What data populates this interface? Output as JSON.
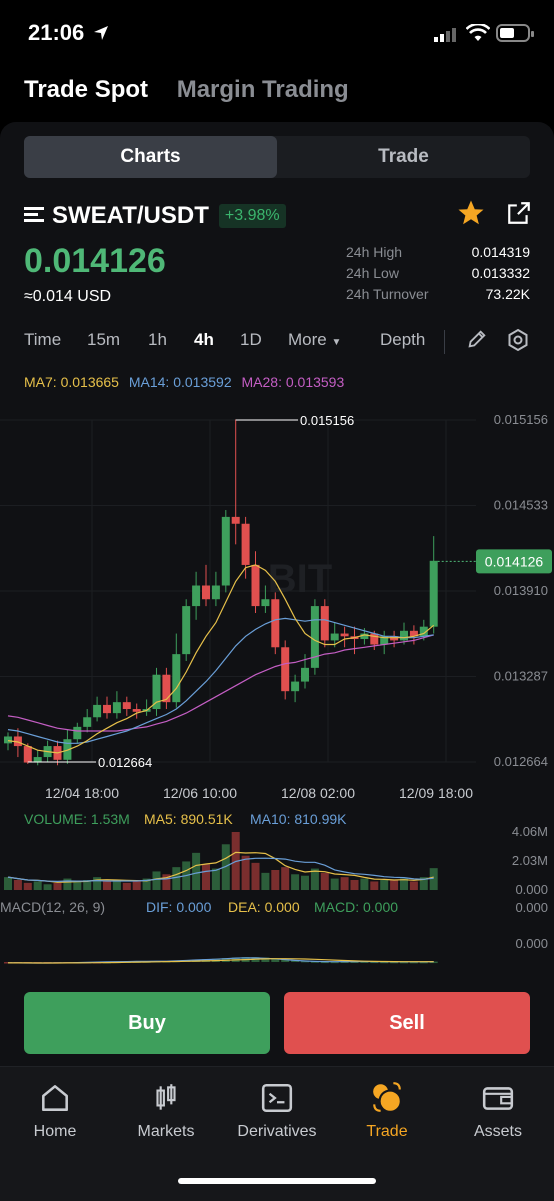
{
  "status_bar": {
    "time": "21:06"
  },
  "top_tabs": [
    "Trade Spot",
    "Margin Trading"
  ],
  "segment": {
    "charts": "Charts",
    "trade": "Trade"
  },
  "pair": {
    "name": "SWEAT/USDT",
    "change": "+3.98%"
  },
  "price": {
    "last": "0.014126",
    "usd": "≈0.014 USD"
  },
  "stats": {
    "high_label": "24h High",
    "high": "0.014319",
    "low_label": "24h Low",
    "low": "0.013332",
    "turnover_label": "24h Turnover",
    "turnover": "73.22K"
  },
  "timeframes": {
    "time": "Time",
    "m15": "15m",
    "h1": "1h",
    "h4": "4h",
    "d1": "1D",
    "more": "More",
    "depth": "Depth",
    "active": "4h"
  },
  "ma_legend": {
    "ma7": "MA7: 0.013665",
    "ma14": "MA14: 0.013592",
    "ma28": "MA28: 0.013593"
  },
  "volume_legend": {
    "vol": "VOLUME: 1.53M",
    "ma5": "MA5: 890.51K",
    "ma10": "MA10: 810.99K"
  },
  "macd_legend": {
    "macd": "MACD(12, 26, 9)",
    "dif": "DIF: 0.000",
    "dea": "DEA: 0.000",
    "val": "MACD: 0.000"
  },
  "colors": {
    "up": "#3e9f5c",
    "down": "#e0504f",
    "ma7": "#e6c04a",
    "ma14": "#6a9fd8",
    "ma28": "#c45ec4",
    "accent": "#f5a623"
  },
  "chart_data": {
    "type": "candlestick",
    "price_axis": [
      "0.015156",
      "0.014533",
      "0.013910",
      "0.013287",
      "0.012664"
    ],
    "volume_axis": [
      "4.06M",
      "2.03M",
      "0.000"
    ],
    "macd_axis": [
      "0.000",
      "0.000"
    ],
    "time_labels": [
      "12/04 18:00",
      "12/06 10:00",
      "12/08 02:00",
      "12/09 18:00"
    ],
    "high_marker": "0.015156",
    "low_marker": "0.012664",
    "last_price_tag": "0.014126",
    "candles": [
      [
        0.0128,
        0.01285,
        0.01275,
        0.01288
      ],
      [
        0.01285,
        0.01278,
        0.0127,
        0.01291
      ],
      [
        0.01278,
        0.01266,
        0.01265,
        0.0128
      ],
      [
        0.01266,
        0.0127,
        0.01264,
        0.01275
      ],
      [
        0.0127,
        0.01278,
        0.01266,
        0.01282
      ],
      [
        0.01278,
        0.01268,
        0.01264,
        0.01282
      ],
      [
        0.01268,
        0.01283,
        0.01265,
        0.0129
      ],
      [
        0.01283,
        0.01292,
        0.0128,
        0.01295
      ],
      [
        0.01292,
        0.01299,
        0.01288,
        0.01305
      ],
      [
        0.01299,
        0.01308,
        0.01296,
        0.01314
      ],
      [
        0.01308,
        0.01302,
        0.01298,
        0.01314
      ],
      [
        0.01302,
        0.0131,
        0.01298,
        0.01318
      ],
      [
        0.0131,
        0.01305,
        0.013,
        0.01314
      ],
      [
        0.01305,
        0.01303,
        0.01298,
        0.01309
      ],
      [
        0.01303,
        0.01305,
        0.013,
        0.01312
      ],
      [
        0.01305,
        0.0133,
        0.013,
        0.01335
      ],
      [
        0.0133,
        0.0131,
        0.01305,
        0.01335
      ],
      [
        0.0131,
        0.01345,
        0.01306,
        0.0136
      ],
      [
        0.01345,
        0.0138,
        0.0134,
        0.01385
      ],
      [
        0.0138,
        0.01395,
        0.0137,
        0.01405
      ],
      [
        0.01395,
        0.01385,
        0.0138,
        0.0141
      ],
      [
        0.01385,
        0.01395,
        0.0138,
        0.01405
      ],
      [
        0.01395,
        0.01445,
        0.0139,
        0.0145
      ],
      [
        0.01445,
        0.0144,
        0.01425,
        0.01516
      ],
      [
        0.0144,
        0.0141,
        0.014,
        0.01445
      ],
      [
        0.0141,
        0.0138,
        0.01375,
        0.0142
      ],
      [
        0.0138,
        0.01385,
        0.01375,
        0.01395
      ],
      [
        0.01385,
        0.0135,
        0.01345,
        0.0139
      ],
      [
        0.0135,
        0.01318,
        0.01312,
        0.01355
      ],
      [
        0.01318,
        0.01325,
        0.0131,
        0.0133
      ],
      [
        0.01325,
        0.01335,
        0.0132,
        0.01345
      ],
      [
        0.01335,
        0.0138,
        0.0133,
        0.01385
      ],
      [
        0.0138,
        0.01355,
        0.0135,
        0.01385
      ],
      [
        0.01355,
        0.0136,
        0.0135,
        0.01368
      ],
      [
        0.0136,
        0.01358,
        0.0135,
        0.01365
      ],
      [
        0.01358,
        0.01356,
        0.01345,
        0.01365
      ],
      [
        0.01356,
        0.0136,
        0.01352,
        0.01364
      ],
      [
        0.0136,
        0.01352,
        0.01348,
        0.01362
      ],
      [
        0.01352,
        0.01358,
        0.01345,
        0.01362
      ],
      [
        0.01358,
        0.01355,
        0.0135,
        0.01362
      ],
      [
        0.01355,
        0.01362,
        0.01352,
        0.01368
      ],
      [
        0.01362,
        0.01358,
        0.01352,
        0.01366
      ],
      [
        0.01358,
        0.01365,
        0.01355,
        0.0137
      ],
      [
        0.01365,
        0.01413,
        0.0136,
        0.01431
      ]
    ],
    "volumes": [
      0.9,
      0.7,
      0.5,
      0.6,
      0.4,
      0.5,
      0.8,
      0.6,
      0.7,
      0.9,
      0.6,
      0.7,
      0.5,
      0.6,
      0.8,
      1.3,
      1.1,
      1.6,
      2.0,
      2.6,
      1.8,
      1.5,
      3.2,
      4.06,
      2.4,
      1.9,
      1.2,
      1.4,
      1.6,
      1.1,
      1.0,
      1.5,
      1.2,
      0.8,
      0.9,
      0.7,
      0.8,
      0.6,
      0.7,
      0.7,
      0.8,
      0.6,
      0.9,
      1.53
    ],
    "ma7": [
      0.01282,
      0.01281,
      0.01278,
      0.01275,
      0.01274,
      0.01273,
      0.01275,
      0.01278,
      0.01282,
      0.01287,
      0.01291,
      0.01295,
      0.01298,
      0.01302,
      0.01304,
      0.0131,
      0.01312,
      0.0132,
      0.01332,
      0.01346,
      0.01358,
      0.01368,
      0.01383,
      0.01398,
      0.01408,
      0.0141,
      0.01406,
      0.01398,
      0.01385,
      0.01371,
      0.0136,
      0.01355,
      0.01352,
      0.01352,
      0.01356,
      0.01357,
      0.01359,
      0.01358,
      0.01357,
      0.01357,
      0.01357,
      0.01358,
      0.0136,
      0.01366
    ],
    "ma14": [
      0.0129,
      0.01289,
      0.01287,
      0.01285,
      0.01283,
      0.01281,
      0.0128,
      0.0128,
      0.01281,
      0.01283,
      0.01285,
      0.01287,
      0.01289,
      0.01292,
      0.01295,
      0.01298,
      0.01301,
      0.01305,
      0.01311,
      0.01318,
      0.01325,
      0.01333,
      0.01342,
      0.01351,
      0.01358,
      0.01363,
      0.01367,
      0.0137,
      0.01371,
      0.0137,
      0.01369,
      0.0137,
      0.0137,
      0.01368,
      0.01366,
      0.01364,
      0.01362,
      0.0136,
      0.01358,
      0.01358,
      0.01357,
      0.01357,
      0.01358,
      0.01359
    ],
    "ma28": [
      0.013,
      0.01299,
      0.01297,
      0.01295,
      0.01293,
      0.01291,
      0.0129,
      0.01289,
      0.01289,
      0.01289,
      0.01289,
      0.01289,
      0.0129,
      0.01291,
      0.01292,
      0.01294,
      0.01296,
      0.01299,
      0.01302,
      0.01306,
      0.0131,
      0.01314,
      0.01318,
      0.01322,
      0.01326,
      0.0133,
      0.01333,
      0.01336,
      0.01338,
      0.01339,
      0.01341,
      0.01343,
      0.01345,
      0.01346,
      0.01348,
      0.01349,
      0.0135,
      0.01351,
      0.01352,
      0.01353,
      0.01354,
      0.01355,
      0.01357,
      0.01359
    ]
  },
  "actions": {
    "buy": "Buy",
    "sell": "Sell"
  },
  "bottom_nav": [
    {
      "label": "Home",
      "icon": "home-icon"
    },
    {
      "label": "Markets",
      "icon": "markets-icon"
    },
    {
      "label": "Derivatives",
      "icon": "derivatives-icon"
    },
    {
      "label": "Trade",
      "icon": "trade-icon",
      "active": true
    },
    {
      "label": "Assets",
      "icon": "wallet-icon"
    }
  ]
}
